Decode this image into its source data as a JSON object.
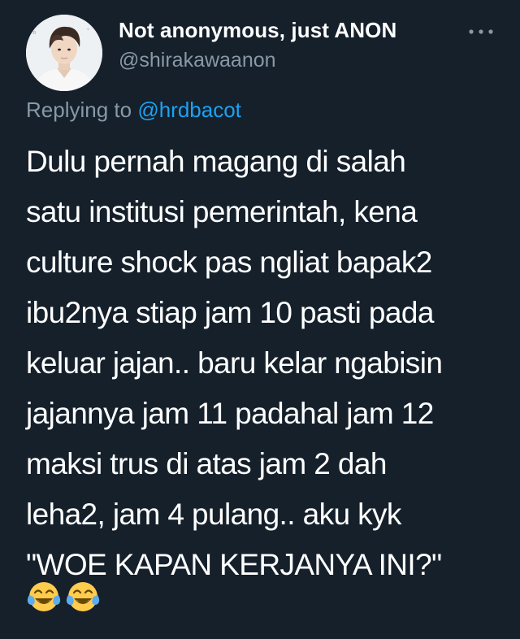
{
  "tweet": {
    "author": {
      "display_name": "Not anonymous, just ANON",
      "handle": "@shirakawaanon",
      "avatar_icon": "profile-photo"
    },
    "more_icon": "ellipsis-icon",
    "reply": {
      "prefix": "Replying to",
      "mention": "@hrdbacot"
    },
    "body_lines": [
      "Dulu pernah magang di salah",
      "satu institusi pemerintah, kena",
      "culture shock pas ngliat bapak2",
      "ibu2nya stiap jam 10 pasti pada",
      "keluar jajan.. baru kelar ngabisin",
      "jajannya jam 11 padahal jam 12",
      "maksi trus di atas jam 2 dah",
      "leha2, jam 4 pulang.. aku kyk",
      "\"WOE KAPAN KERJANYA INI?\""
    ],
    "emojis": [
      "face-with-tears-of-joy",
      "face-with-tears-of-joy"
    ]
  },
  "colors": {
    "background": "#15202b",
    "primary_text": "#ffffff",
    "secondary_text": "#8899a6",
    "link": "#1da1f2"
  }
}
